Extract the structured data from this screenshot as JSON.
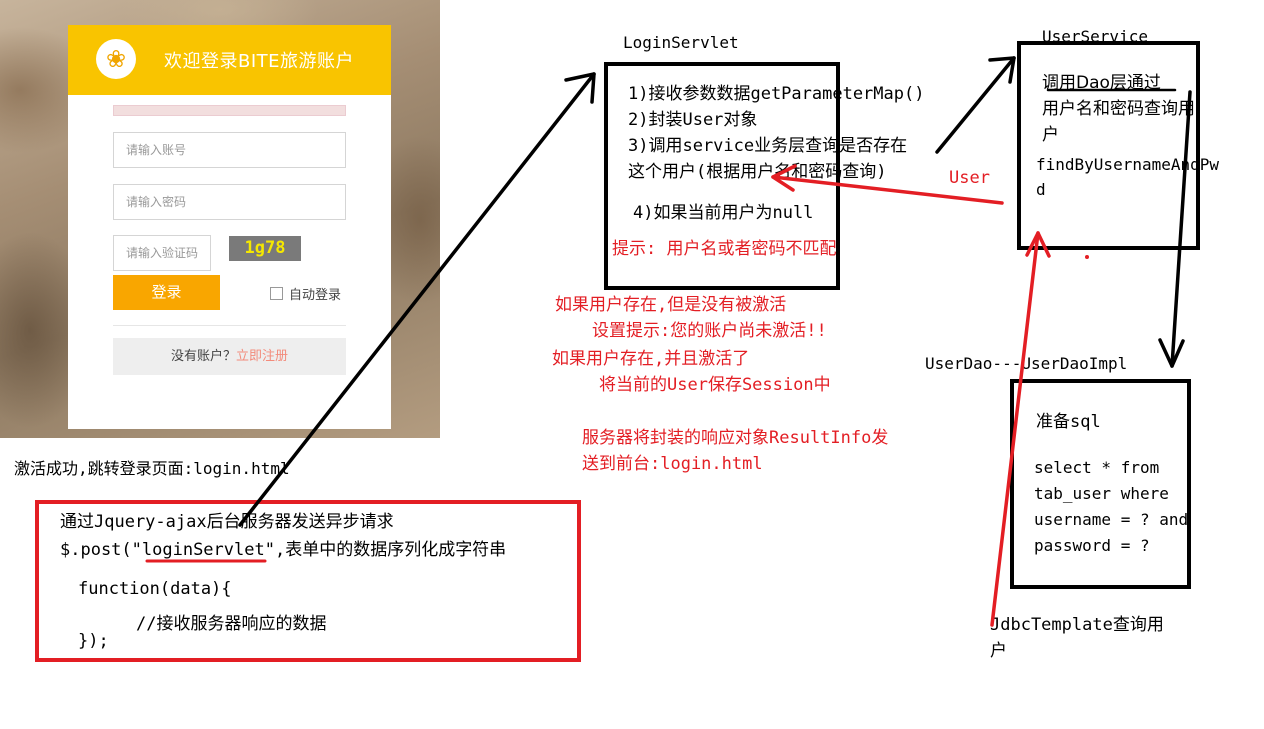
{
  "login_page": {
    "title": "欢迎登录BITE旅游账户",
    "username_placeholder": "请输入账号",
    "password_placeholder": "请输入密码",
    "captcha_placeholder": "请输入验证码",
    "captcha_text": "1g78",
    "login_button": "登录",
    "auto_login_label": "自动登录",
    "register_prompt": "没有账户？",
    "register_link": "立即注册"
  },
  "activation_note": "激活成功,跳转登录页面:login.html",
  "client_box": {
    "line1": "通过Jquery-ajax后台服务器发送异步请求",
    "line2_prefix": "$.post(",
    "line2_servlet": "\"loginServlet\"",
    "line2_suffix": ",表单中的数据序列化成字符串",
    "line3": "function(data){",
    "line4": "//接收服务器响应的数据",
    "line5": "});"
  },
  "login_servlet": {
    "title": "LoginServlet",
    "step1": "1)接收参数数据getParameterMap()",
    "step2": "2)封装User对象",
    "step3a": "3)调用service业务层查询是否存在",
    "step3b": "这个用户(根据用户名和密码查询)",
    "step4": "4)如果当前用户为null",
    "hint": "提示:  用户名或者密码不匹配"
  },
  "user_arrow_label": "User",
  "notes": {
    "not_activated": "如果用户存在,但是没有被激活",
    "not_activated_hint": "设置提示:您的账户尚未激活!!",
    "activated": "如果用户存在,并且激活了",
    "save_session": "将当前的User保存Session中",
    "response1": "服务器将封装的响应对象ResultInfo发",
    "response2": "送到前台:login.html"
  },
  "user_service": {
    "title": "UserService",
    "line1": "调用Dao层通过",
    "line2": "用户名和密码查询用",
    "line3": "户",
    "method1": "findByUsernameAndPw",
    "method2": "d"
  },
  "user_dao": {
    "title": "UserDao---UserDaoImpl",
    "prepare": "准备sql",
    "sql1": "select * from",
    "sql2": "tab_user where",
    "sql3": "username = ? and",
    "sql4": "password = ?"
  },
  "jdbc_note": {
    "line1": "JdbcTemplate查询用",
    "line2": "户"
  }
}
